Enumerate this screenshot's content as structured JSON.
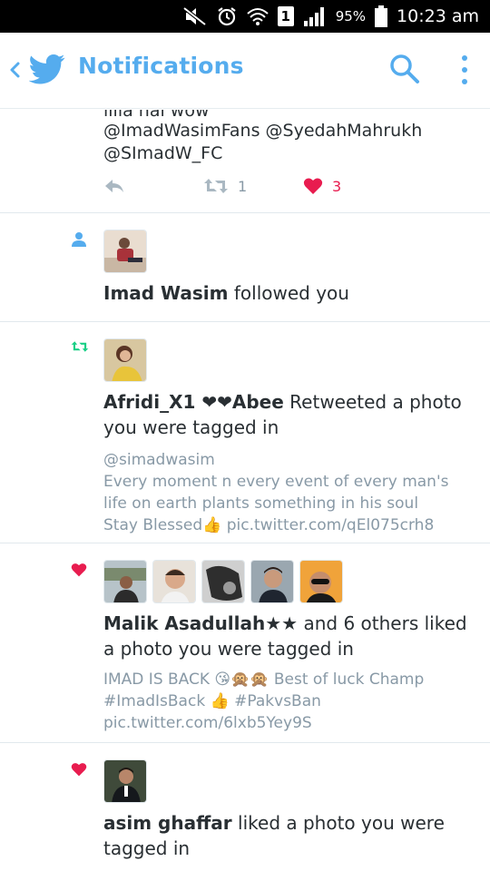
{
  "status_bar": {
    "battery": "95%",
    "time": "10:23 am",
    "sim": "1"
  },
  "app_bar": {
    "title": "Notifications"
  },
  "top_tweet": {
    "cut_line": "iiiia nai wow",
    "line1": "@ImadWasimFans @SyedahMahrukh",
    "line2": "@SImadW_FC",
    "retweet_count": "1",
    "like_count": "3"
  },
  "notifications": [
    {
      "type": "follow",
      "name": "Imad Wasim",
      "action": " followed you"
    },
    {
      "type": "retweet",
      "name": "Afridi_X1 ❤❤Abee",
      "action": " Retweeted a photo you were tagged in",
      "sub_line1": "@simadwasim",
      "sub_line2": "Every moment n every event of every man's",
      "sub_line3": "life on earth plants something in his soul",
      "sub_line4": "Stay Blessed👍 pic.twitter.com/qEl075crh8"
    },
    {
      "type": "like",
      "name": "Malik Asadullah★★",
      "action": " and 6 others liked a photo you were tagged in",
      "sub_line1": "IMAD IS BACK 😘🙊🙊 Best of luck Champ",
      "sub_line2": "#ImadIsBack 👍 #PakvsBan",
      "sub_line3": "pic.twitter.com/6lxb5Yey9S"
    },
    {
      "type": "like",
      "name": "asim ghaffar",
      "action": " liked a photo you were tagged in"
    }
  ],
  "colors": {
    "twitter_blue": "#55acee",
    "retweet_green": "#19cf86",
    "like_red": "#e81c4f",
    "muted": "#8899a6"
  }
}
